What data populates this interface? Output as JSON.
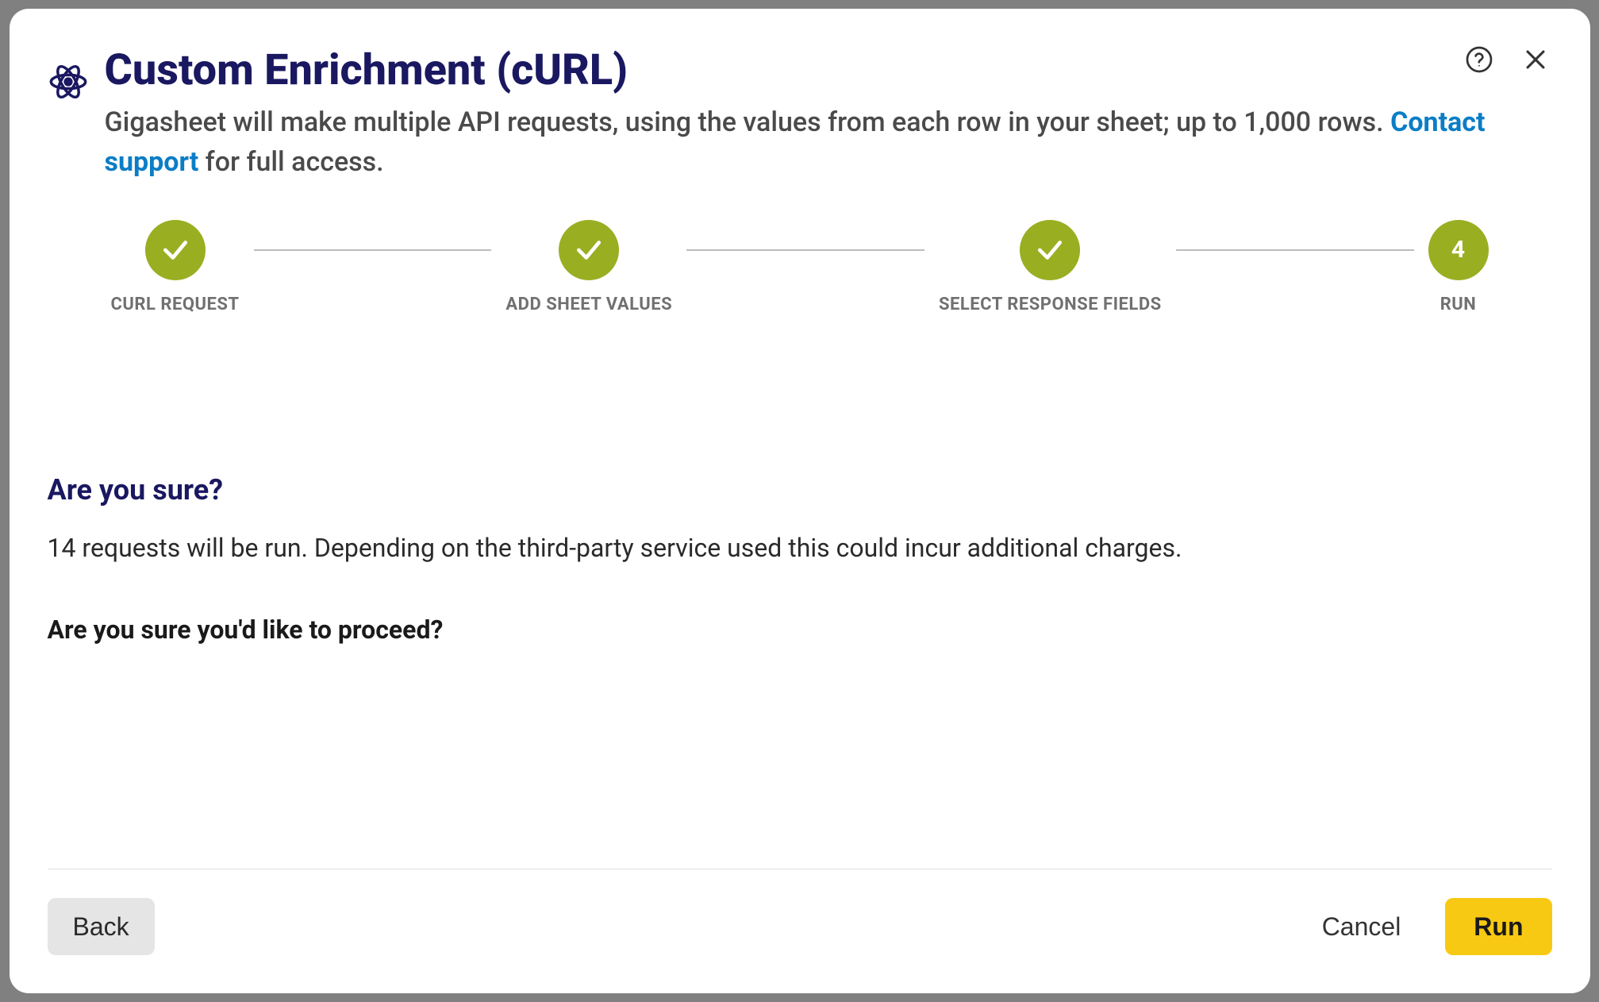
{
  "modal": {
    "title": "Custom Enrichment (cURL)",
    "subtitle_prefix": "Gigasheet will make multiple API requests, using the values from each row in your sheet; up to 1,000 rows. ",
    "subtitle_link": "Contact support",
    "subtitle_suffix": " for full access."
  },
  "steps": [
    {
      "label": "CURL REQUEST",
      "state": "done"
    },
    {
      "label": "ADD SHEET VALUES",
      "state": "done"
    },
    {
      "label": "SELECT RESPONSE FIELDS",
      "state": "done"
    },
    {
      "label": "RUN",
      "state": "current",
      "number": "4"
    }
  ],
  "confirm": {
    "heading": "Are you sure?",
    "text": "14 requests will be run. Depending on the third-party service used this could incur additional charges.",
    "proceed": "Are you sure you'd like to proceed?"
  },
  "footer": {
    "back": "Back",
    "cancel": "Cancel",
    "run": "Run"
  }
}
